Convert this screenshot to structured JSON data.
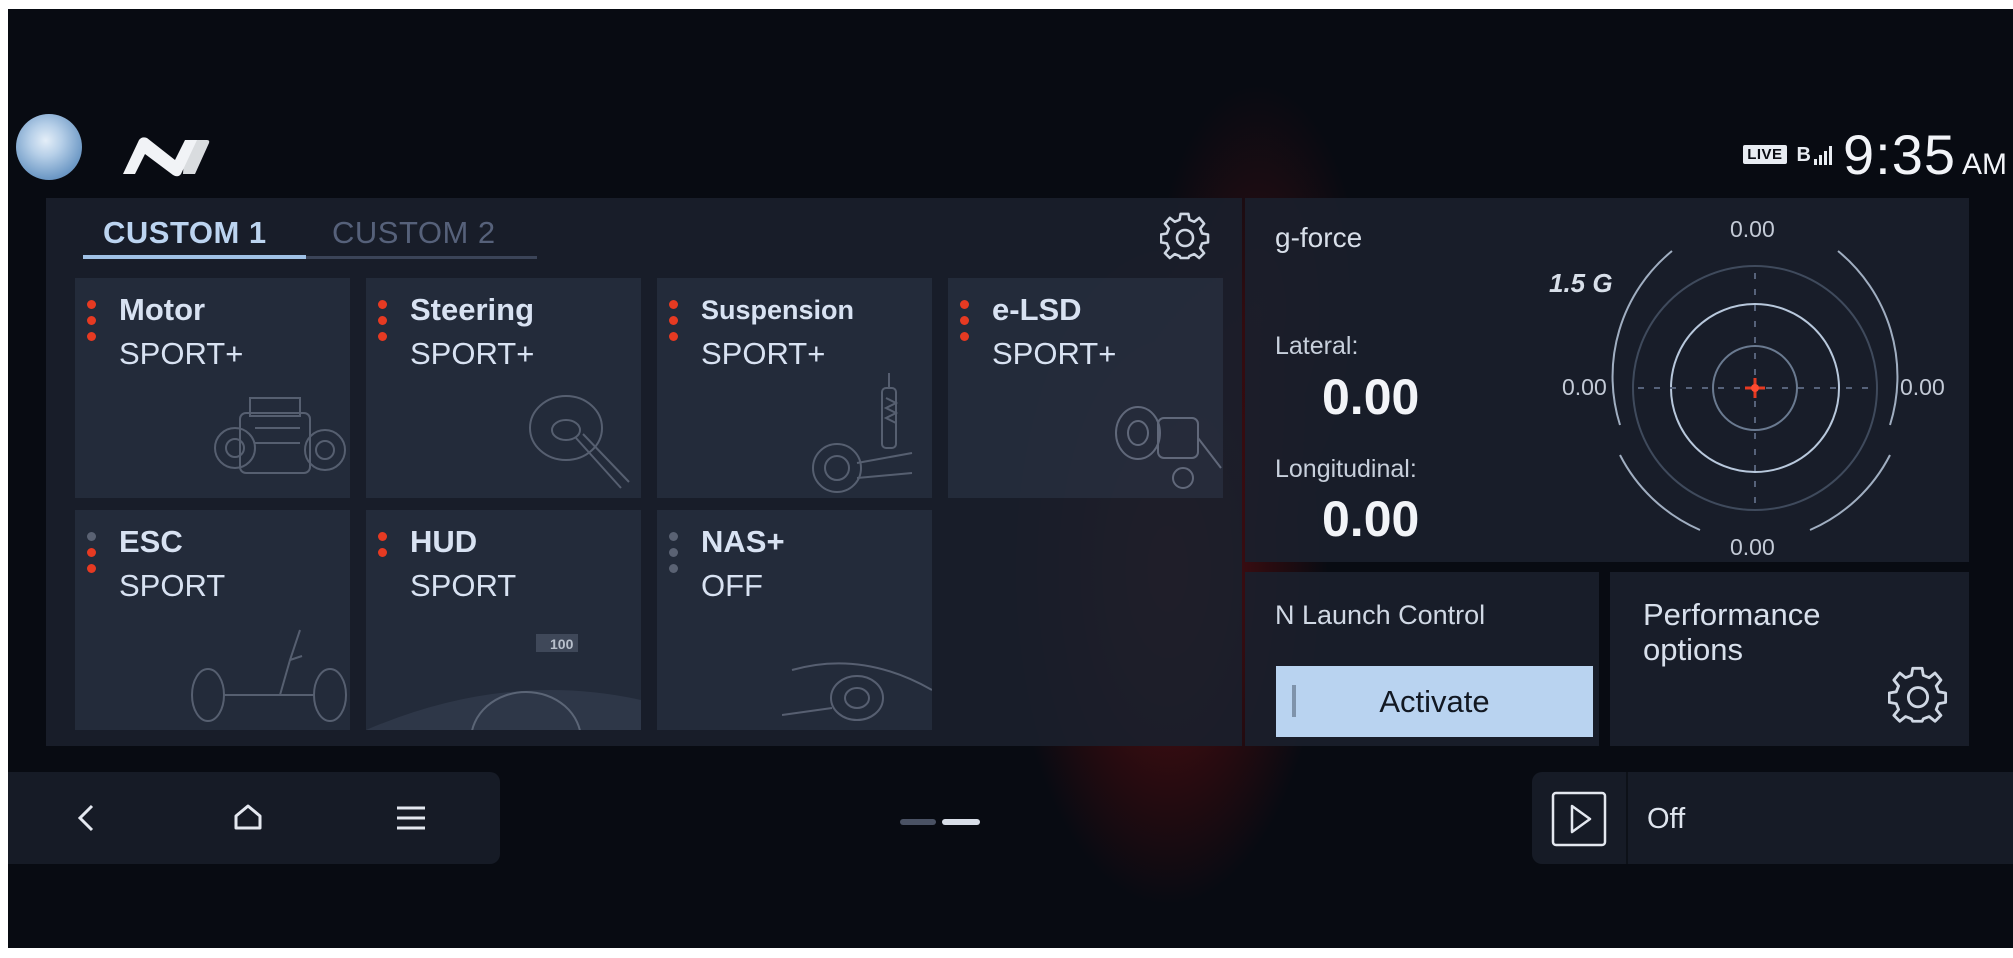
{
  "status_bar": {
    "live_badge": "LIVE",
    "bt_signal": "B",
    "time": "9:35",
    "ampm": "AM"
  },
  "tabs": [
    {
      "label": "CUSTOM 1",
      "active": true
    },
    {
      "label": "CUSTOM 2",
      "active": false
    }
  ],
  "tiles": [
    {
      "name": "Motor",
      "value": "SPORT+",
      "levels": 3,
      "active_levels": 3
    },
    {
      "name": "Steering",
      "value": "SPORT+",
      "levels": 3,
      "active_levels": 3
    },
    {
      "name": "Suspension",
      "value": "SPORT+",
      "levels": 3,
      "active_levels": 3
    },
    {
      "name": "e-LSD",
      "value": "SPORT+",
      "levels": 3,
      "active_levels": 3
    },
    {
      "name": "ESC",
      "value": "SPORT",
      "levels": 3,
      "active_levels": 2
    },
    {
      "name": "HUD",
      "value": "SPORT",
      "levels": 2,
      "active_levels": 2
    },
    {
      "name": "NAS+",
      "value": "OFF",
      "levels": 3,
      "active_levels": 0
    }
  ],
  "hud_art_label": "100",
  "gforce": {
    "title": "g-force",
    "scale": "1.5 G",
    "lateral_label": "Lateral:",
    "lateral_value": "0.00",
    "longitudinal_label": "Longitudinal:",
    "longitudinal_value": "0.00",
    "top": "0.00",
    "bottom": "0.00",
    "left": "0.00",
    "right": "0.00"
  },
  "launch_control": {
    "label": "N Launch Control",
    "button": "Activate"
  },
  "performance": {
    "label": "Performance options"
  },
  "media": {
    "status": "Off"
  },
  "colors": {
    "accent_red": "#e63a22",
    "accent_blue": "#b9d3f0",
    "inactive_dot": "#5a6273",
    "background": "#080b12"
  },
  "icons": [
    "n-logo-icon",
    "gear-icon",
    "back-icon",
    "home-icon",
    "menu-icon",
    "play-icon"
  ]
}
